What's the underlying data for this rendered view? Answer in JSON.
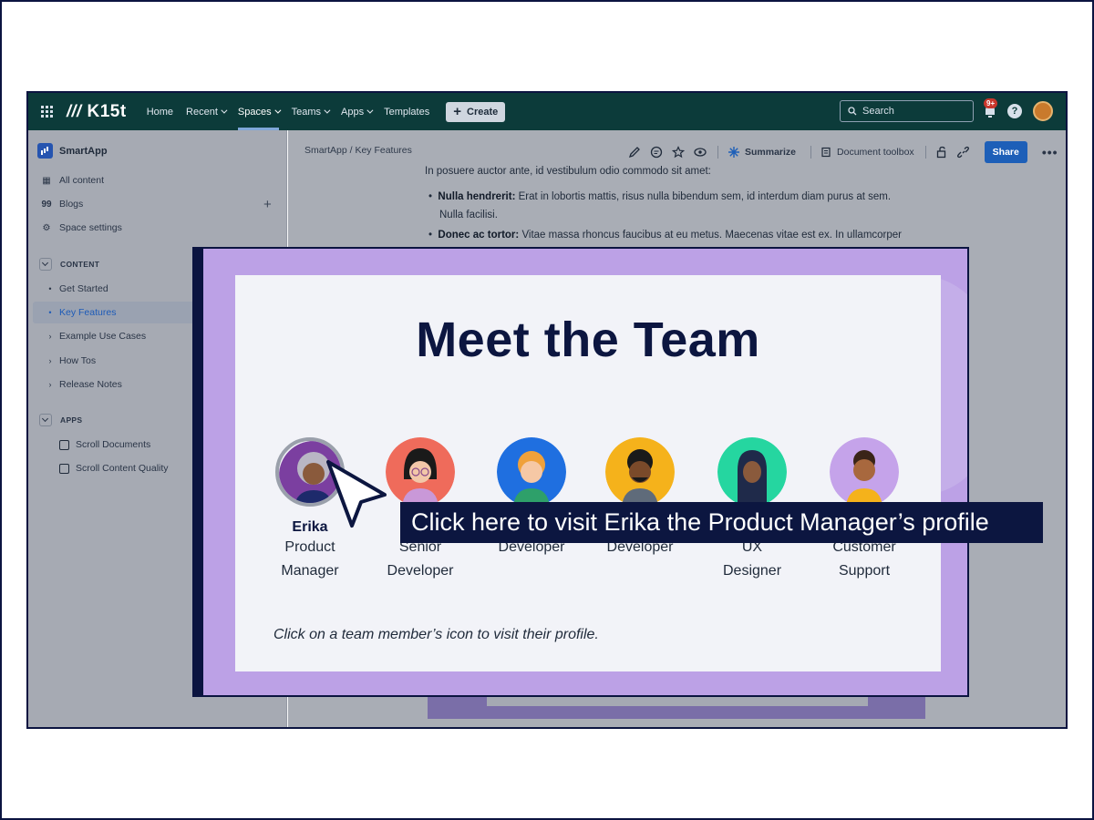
{
  "topnav": {
    "logo": "K15t",
    "items": [
      "Home",
      "Recent",
      "Spaces",
      "Teams",
      "Apps",
      "Templates"
    ],
    "create_label": "Create",
    "search_placeholder": "Search",
    "notification_badge": "9+",
    "help_label": "?"
  },
  "sidebar": {
    "space_name": "SmartApp",
    "links": [
      {
        "label": "All content",
        "icon": "grid-icon"
      },
      {
        "label": "Blogs",
        "icon": "quote-icon"
      },
      {
        "label": "Space settings",
        "icon": "gear-icon"
      }
    ],
    "content_header": "CONTENT",
    "content_items": [
      "Get Started",
      "Key Features",
      "Example Use Cases",
      "How Tos",
      "Release Notes"
    ],
    "active_item": "Key Features",
    "apps_header": "APPS",
    "apps": [
      "Scroll Documents",
      "Scroll Content Quality"
    ]
  },
  "main": {
    "breadcrumb": "SmartApp  /  Key Features",
    "summarize_label": "Summarize",
    "doc_toolbox_label": "Document toolbox",
    "share_label": "Share",
    "more_label": "•••",
    "doc": {
      "intro": "In posuere auctor ante, id vestibulum odio commodo sit amet:",
      "bullet1_bold": "Nulla hendrerit:",
      "bullet1_text": " Erat in lobortis mattis, risus nulla bibendum sem, id interdum diam purus at sem.",
      "bullet1_cont": "Nulla facilisi.",
      "bullet2_bold": "Donec ac tortor:",
      "bullet2_text": " Vitae massa rhoncus faucibus at eu metus. Maecenas vitae est ex. In ullamcorper"
    }
  },
  "slide": {
    "title": "Meet the Team",
    "members": [
      {
        "name": "Erika",
        "role1": "Product",
        "role2": "Manager",
        "color": "#7b3fa0"
      },
      {
        "name": "",
        "role1": "Senior",
        "role2": "Developer",
        "color": "#ef6b5b"
      },
      {
        "name": "",
        "role1": "Developer",
        "role2": "",
        "color": "#1f6fe0"
      },
      {
        "name": "",
        "role1": "Developer",
        "role2": "",
        "color": "#f5b21b"
      },
      {
        "name": "",
        "role1": "UX",
        "role2": "Designer",
        "color": "#25d6a0"
      },
      {
        "name": "",
        "role1": "Customer",
        "role2": "Support",
        "color": "#c5a3ea"
      }
    ],
    "footer": "Click on a team member’s icon to visit their profile.",
    "tooltip": "Click here to visit Erika the Product Manager’s profile"
  }
}
